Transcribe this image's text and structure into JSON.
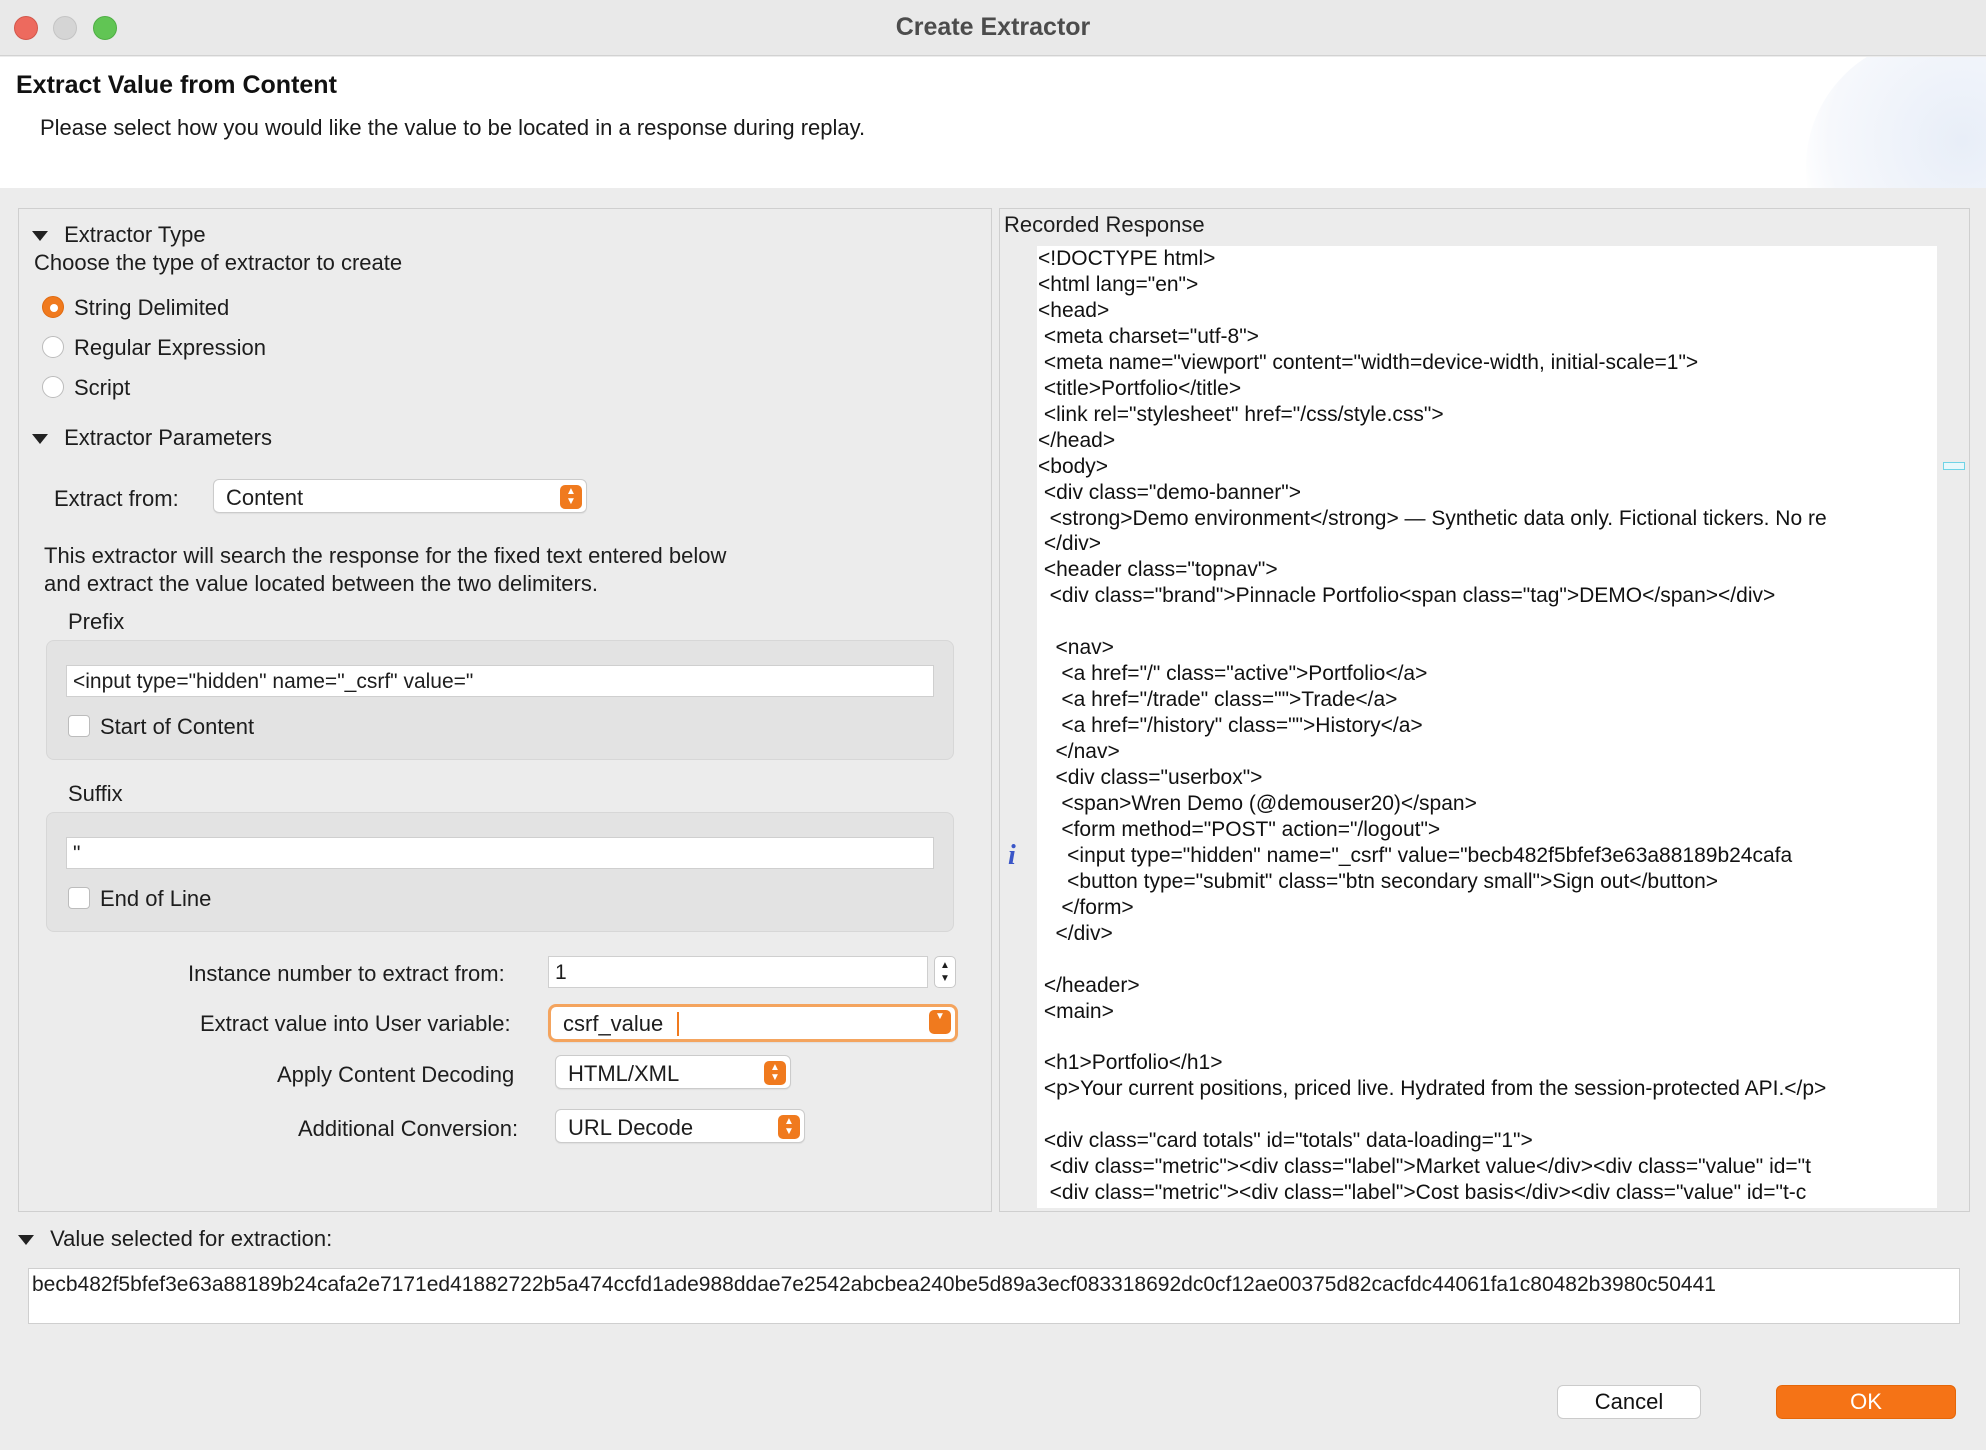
{
  "window": {
    "title": "Create Extractor"
  },
  "header": {
    "title": "Extract Value from Content",
    "description": "Please select how you would like the value to be located in a response during replay."
  },
  "extractor_type": {
    "section_label": "Extractor Type",
    "instruction": "Choose the type of extractor to create",
    "options": [
      {
        "label": "String Delimited",
        "selected": true
      },
      {
        "label": "Regular Expression",
        "selected": false
      },
      {
        "label": "Script",
        "selected": false
      }
    ]
  },
  "params": {
    "section_label": "Extractor Parameters",
    "extract_from_label": "Extract from:",
    "extract_from_value": "Content",
    "description_line1": "This extractor will search the response for the fixed text entered below",
    "description_line2": "and extract the value located between the two delimiters.",
    "prefix_label": "Prefix",
    "prefix_value": "<input type=\"hidden\" name=\"_csrf\" value=\"",
    "start_of_content_label": "Start of Content",
    "suffix_label": "Suffix",
    "suffix_value": "\"",
    "end_of_line_label": "End of Line",
    "instance_label": "Instance number to extract from:",
    "instance_value": "1",
    "user_var_label": "Extract value into User variable:",
    "user_var_value": "csrf_value",
    "decoding_label": "Apply Content Decoding",
    "decoding_value": "HTML/XML",
    "conversion_label": "Additional Conversion:",
    "conversion_value": "URL Decode"
  },
  "recorded_response": {
    "label": "Recorded Response",
    "lines": [
      "<!DOCTYPE html>",
      "<html lang=\"en\">",
      "<head>",
      " <meta charset=\"utf-8\">",
      " <meta name=\"viewport\" content=\"width=device-width, initial-scale=1\">",
      " <title>Portfolio</title>",
      " <link rel=\"stylesheet\" href=\"/css/style.css\">",
      "</head>",
      "<body>",
      " <div class=\"demo-banner\">",
      "  <strong>Demo environment</strong> — Synthetic data only. Fictional tickers. No re",
      " </div>",
      " <header class=\"topnav\">",
      "  <div class=\"brand\">Pinnacle Portfolio<span class=\"tag\">DEMO</span></div>",
      "",
      "   <nav>",
      "    <a href=\"/\" class=\"active\">Portfolio</a>",
      "    <a href=\"/trade\" class=\"\">Trade</a>",
      "    <a href=\"/history\" class=\"\">History</a>",
      "   </nav>",
      "   <div class=\"userbox\">",
      "    <span>Wren Demo (@demouser20)</span>",
      "    <form method=\"POST\" action=\"/logout\">",
      "     <input type=\"hidden\" name=\"_csrf\" value=\"becb482f5bfef3e63a88189b24cafa",
      "     <button type=\"submit\" class=\"btn secondary small\">Sign out</button>",
      "    </form>",
      "   </div>",
      "",
      " </header>",
      " <main>",
      "",
      " <h1>Portfolio</h1>",
      " <p>Your current positions, priced live. Hydrated from the session-protected API.</p>",
      "",
      " <div class=\"card totals\" id=\"totals\" data-loading=\"1\">",
      "  <div class=\"metric\"><div class=\"label\">Market value</div><div class=\"value\" id=\"t",
      "  <div class=\"metric\"><div class=\"label\">Cost basis</div><div class=\"value\" id=\"t-c"
    ]
  },
  "value_selected": {
    "label": "Value selected for extraction:",
    "value": "becb482f5bfef3e63a88189b24cafa2e7171ed41882722b5a474ccfd1ade988ddae7e2542abcbea240be5d89a3ecf083318692dc0cf12ae00375d82cacfdc44061fa1c80482b3980c50441"
  },
  "buttons": {
    "cancel": "Cancel",
    "ok": "OK"
  },
  "colors": {
    "accent": "#f57316",
    "info": "#3a56c8"
  }
}
